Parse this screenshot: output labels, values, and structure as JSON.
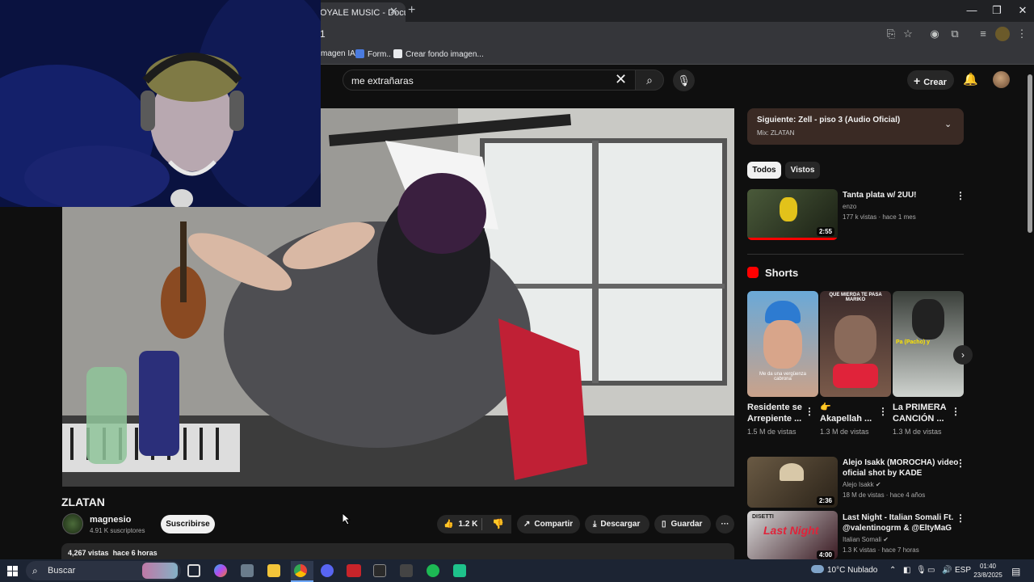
{
  "browser": {
    "tab_title": "OYALE MUSIC - Docu",
    "tab_close": "✕",
    "new_tab": "+",
    "url_fragment": "1",
    "window_controls": [
      "—",
      "❐",
      "✕"
    ],
    "bookmarks": [
      "magen IA",
      "Form..",
      "Crear fondo imagen..."
    ]
  },
  "header": {
    "search_value": "me extrañaras",
    "clear_glyph": "✕",
    "search_glyph": "⌕",
    "mic_glyph": "🎙",
    "create_label": "Crear",
    "bell_glyph": "🔔"
  },
  "video": {
    "title": "ZLATAN",
    "channel": "magnesio",
    "subscribers": "4.91 K suscriptores",
    "subscribe_label": "Suscribirse",
    "likes": "1.2 K",
    "share_label": "Compartir",
    "download_label": "Descargar",
    "save_label": "Guardar",
    "more_glyph": "···",
    "views": "4,267 vistas",
    "uploaded": "hace 6 horas"
  },
  "sidebar": {
    "next_title": "Siguiente: Zell - piso 3 (Audio Oficial)",
    "next_sub": "Mix: ZLATAN",
    "chips": [
      "Todos",
      "Vistos"
    ],
    "rec1": {
      "title": "Tanta plata w/ 2UU!",
      "channel": "enzo",
      "meta": "177 k vistas · hace 1 mes",
      "duration": "2:55"
    },
    "shorts_label": "Shorts",
    "shorts": [
      {
        "title1": "Residente se",
        "title2": "Arrepiente ...",
        "views": "1.5 M de vistas",
        "caption": "Me da una vergüenza cabrona"
      },
      {
        "title1": "👉",
        "title2": "Akapellah ...",
        "views": "1.3 M de vistas",
        "caption": "QUE MIERDA TE PASA MARIKO"
      },
      {
        "title1": "La PRIMERA",
        "title2": "CANCIÓN ...",
        "views": "1.3 M de vistas",
        "caption": "Pa (Pacho) y"
      }
    ],
    "rec2": {
      "title1": "Alejo Isakk (MOROCHA) video",
      "title2": "oficial shot by KADE",
      "channel": "Alejo Isakk",
      "meta": "18 M de vistas · hace 4 años",
      "duration": "2:36"
    },
    "rec3": {
      "title1": "Last Night - Italian Somali Ft.",
      "title2": "@valentinogrm & @EltyMaG",
      "channel": "Italian Somali",
      "meta": "1.3 K vistas · hace 7 horas",
      "duration": "4:00"
    }
  },
  "taskbar": {
    "search_placeholder": "Buscar",
    "weather": "10°C  Nublado",
    "lang": "ESP",
    "time": "01:40",
    "date": "23/8/2025"
  },
  "colors": {
    "accent": "#ff0000",
    "bg": "#0f0f0f",
    "chip_active": "#f1f1f1"
  }
}
